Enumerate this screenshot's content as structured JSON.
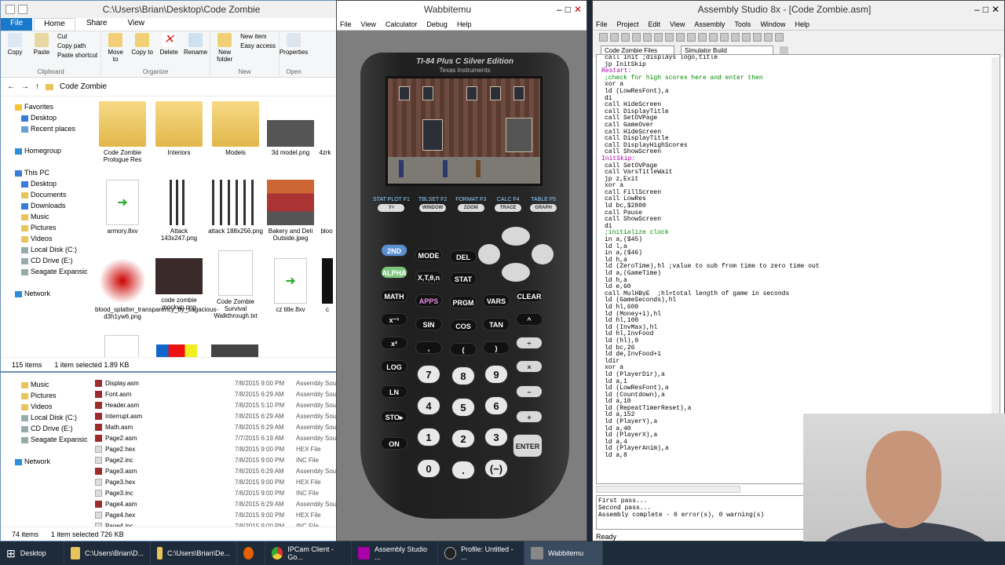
{
  "explorer": {
    "title": "C:\\Users\\Brian\\Desktop\\Code Zombie",
    "tabs": [
      "Home",
      "Share",
      "View"
    ],
    "file_tab": "File",
    "ribbon": {
      "clipboard": {
        "label": "Clipboard",
        "copy": "Copy",
        "paste": "Paste",
        "cut": "Cut",
        "copy_path": "Copy path",
        "paste_shortcut": "Paste shortcut"
      },
      "organize": {
        "label": "Organize",
        "move_to": "Move to",
        "copy_to": "Copy to",
        "delete": "Delete",
        "rename": "Rename"
      },
      "new": {
        "label": "New",
        "new_folder": "New folder",
        "new_item": "New item",
        "easy_access": "Easy access"
      },
      "open": {
        "label": "Open",
        "properties": "Properties"
      }
    },
    "breadcrumb": "Code Zombie",
    "nav": [
      {
        "label": "Favorites"
      },
      {
        "label": "Desktop"
      },
      {
        "label": "Recent places"
      },
      {
        "label": "Homegroup"
      },
      {
        "label": "This PC"
      },
      {
        "label": "Desktop"
      },
      {
        "label": "Documents"
      },
      {
        "label": "Downloads"
      },
      {
        "label": "Music"
      },
      {
        "label": "Pictures"
      },
      {
        "label": "Videos"
      },
      {
        "label": "Local Disk (C:)"
      },
      {
        "label": "CD Drive (E:)"
      },
      {
        "label": "Seagate Expansion D"
      },
      {
        "label": "Network"
      }
    ],
    "files": [
      {
        "label": "Code Zombie Prologue Res"
      },
      {
        "label": "Interiors"
      },
      {
        "label": "Models"
      },
      {
        "label": "3d model.png"
      },
      {
        "label": "4zrk"
      },
      {
        "label": "armory.8xv"
      },
      {
        "label": "Attack 143x247.png"
      },
      {
        "label": "attack 188x256.png"
      },
      {
        "label": "Bakery and Deli Outside.jpeg"
      },
      {
        "label": "bloo"
      },
      {
        "label": "blood_splatter_transparency_by_sagacious-d3h1yw6.png"
      },
      {
        "label": "code zombie mockup.png"
      },
      {
        "label": "Code Zombie Survival Walkthrough.txt"
      },
      {
        "label": "cz title.8xv"
      },
      {
        "label": "c"
      }
    ],
    "status_count": "115 items",
    "status_selected": "1 item selected  1.89 KB"
  },
  "explorer2": {
    "nav": [
      {
        "label": "Music"
      },
      {
        "label": "Pictures"
      },
      {
        "label": "Videos"
      },
      {
        "label": "Local Disk (C:)"
      },
      {
        "label": "CD Drive (E:)"
      },
      {
        "label": "Seagate Expansion D"
      },
      {
        "label": "Network"
      }
    ],
    "rows": [
      {
        "name": "Display.asm",
        "date": "7/8/2015 9:00 PM",
        "type": "Assembly Sou"
      },
      {
        "name": "Font.asm",
        "date": "7/8/2015 6:29 AM",
        "type": "Assembly Sou"
      },
      {
        "name": "Header.asm",
        "date": "7/8/2015 5:10 PM",
        "type": "Assembly Sou"
      },
      {
        "name": "Interrupt.asm",
        "date": "7/8/2015 6:29 AM",
        "type": "Assembly Sou"
      },
      {
        "name": "Math.asm",
        "date": "7/8/2015 6:29 AM",
        "type": "Assembly Sou"
      },
      {
        "name": "Page2.asm",
        "date": "7/7/2015 6:19 AM",
        "type": "Assembly Sou"
      },
      {
        "name": "Page2.hex",
        "date": "7/8/2015 9:00 PM",
        "type": "HEX File"
      },
      {
        "name": "Page2.inc",
        "date": "7/8/2015 9:00 PM",
        "type": "INC File"
      },
      {
        "name": "Page3.asm",
        "date": "7/8/2015 6:29 AM",
        "type": "Assembly Sou"
      },
      {
        "name": "Page3.hex",
        "date": "7/8/2015 9:00 PM",
        "type": "HEX File"
      },
      {
        "name": "Page3.inc",
        "date": "7/8/2015 9:00 PM",
        "type": "INC File"
      },
      {
        "name": "Page4.asm",
        "date": "7/8/2015 6:29 AM",
        "type": "Assembly Sou"
      },
      {
        "name": "Page4.hex",
        "date": "7/8/2015 9:00 PM",
        "type": "HEX File"
      },
      {
        "name": "Page4.inc",
        "date": "7/8/2015 9:00 PM",
        "type": "INC File"
      }
    ],
    "status_count": "74 items",
    "status_selected": "1 item selected  726 KB"
  },
  "wabbit": {
    "title": "Wabbitemu",
    "menu": [
      "File",
      "View",
      "Calculator",
      "Debug",
      "Help"
    ],
    "model": "TI-84 Plus C Silver Edition",
    "brand": "Texas Instruments",
    "fkeys": [
      {
        "top": "STAT PLOT F1",
        "key": "Y="
      },
      {
        "top": "TBLSET F2",
        "key": "WINDOW"
      },
      {
        "top": "FORMAT F3",
        "key": "ZOOM"
      },
      {
        "top": "CALC F4",
        "key": "TRACE"
      },
      {
        "top": "TABLE F5",
        "key": "GRAPH"
      }
    ],
    "keys": {
      "second": "2ND",
      "mode": "MODE",
      "del": "DEL",
      "alpha": "ALPHA",
      "xton": "X,T,θ,n",
      "stat": "STAT",
      "math": "MATH",
      "apps": "APPS",
      "prgm": "PRGM",
      "vars": "VARS",
      "clear": "CLEAR",
      "xinv": "x⁻¹",
      "sin": "SIN",
      "cos": "COS",
      "tan": "TAN",
      "pow": "^",
      "sq": "x²",
      "comma": ",",
      "lp": "(",
      "rp": ")",
      "div": "÷",
      "log": "LOG",
      "n7": "7",
      "n8": "8",
      "n9": "9",
      "mul": "×",
      "ln": "LN",
      "n4": "4",
      "n5": "5",
      "n6": "6",
      "sub": "−",
      "sto": "STO▸",
      "n1": "1",
      "n2": "2",
      "n3": "3",
      "add": "+",
      "on": "ON",
      "n0": "0",
      "dot": ".",
      "neg": "(−)",
      "enter": "ENTER"
    }
  },
  "asm": {
    "title": "Assembly Studio 8x - [Code Zombie.asm]",
    "menu": [
      "File",
      "Project",
      "Edit",
      "View",
      "Assembly",
      "Tools",
      "Window",
      "Help"
    ],
    "combo_files": "Code Zombie Files",
    "combo_build": "Simulator Build",
    "code": [
      {
        "c": "l",
        "t": "call Init ;displays logo,title"
      },
      {
        "c": "l",
        "t": "jp InitSkip"
      },
      {
        "c": "lbl",
        "t": "Restart:"
      },
      {
        "c": "cm",
        "t": ";check for high scores here and enter then"
      },
      {
        "c": "l",
        "t": "xor a"
      },
      {
        "c": "l",
        "t": "ld (LowResFont),a"
      },
      {
        "c": "l",
        "t": "di"
      },
      {
        "c": "l",
        "t": "call HideScreen"
      },
      {
        "c": "l",
        "t": "call DisplayTitle"
      },
      {
        "c": "l",
        "t": "call SetOVPage"
      },
      {
        "c": "l",
        "t": "call GameOver"
      },
      {
        "c": "l",
        "t": "call HideScreen"
      },
      {
        "c": "l",
        "t": "call DisplayTitle"
      },
      {
        "c": "l",
        "t": "call DisplayHighScores"
      },
      {
        "c": "l",
        "t": "call ShowScreen"
      },
      {
        "c": "lbl",
        "t": "InitSkip:"
      },
      {
        "c": "l",
        "t": "call SetOVPage"
      },
      {
        "c": "l",
        "t": "call VarsTitleWait"
      },
      {
        "c": "l",
        "t": "jp z,Exit"
      },
      {
        "c": "l",
        "t": "xor a"
      },
      {
        "c": "l",
        "t": "call FillScreen"
      },
      {
        "c": "l",
        "t": "call LowRes"
      },
      {
        "c": "l",
        "t": "ld bc,$2800"
      },
      {
        "c": "l",
        "t": "call Pause"
      },
      {
        "c": "l",
        "t": "call ShowScreen"
      },
      {
        "c": "l",
        "t": ""
      },
      {
        "c": "l",
        "t": "di"
      },
      {
        "c": "cm",
        "t": ";initialize clock"
      },
      {
        "c": "l",
        "t": "in a,($45)"
      },
      {
        "c": "l",
        "t": "ld l,a"
      },
      {
        "c": "l",
        "t": "in a,($46)"
      },
      {
        "c": "l",
        "t": "ld h,a"
      },
      {
        "c": "l",
        "t": "ld (ZeroTime),hl ;value to sub from time to zero time out"
      },
      {
        "c": "l",
        "t": "ld a,(GameTime)"
      },
      {
        "c": "l",
        "t": "ld h,a"
      },
      {
        "c": "l",
        "t": "ld e,60"
      },
      {
        "c": "l",
        "t": "call MulHByE  ;hl=total length of game in seconds"
      },
      {
        "c": "l",
        "t": "ld (GameSeconds),hl"
      },
      {
        "c": "l",
        "t": ""
      },
      {
        "c": "l",
        "t": "ld hl,600"
      },
      {
        "c": "l",
        "t": "ld (Money+1),hl"
      },
      {
        "c": "l",
        "t": "ld hl,100"
      },
      {
        "c": "l",
        "t": "ld (InvMax),hl"
      },
      {
        "c": "l",
        "t": "ld hl,InvFood"
      },
      {
        "c": "l",
        "t": "ld (hl),0"
      },
      {
        "c": "l",
        "t": "ld bc,26"
      },
      {
        "c": "l",
        "t": "ld de,InvFood+1"
      },
      {
        "c": "l",
        "t": "ldir"
      },
      {
        "c": "l",
        "t": ""
      },
      {
        "c": "l",
        "t": "xor a"
      },
      {
        "c": "l",
        "t": "ld (PlayerDir),a"
      },
      {
        "c": "l",
        "t": "ld a,1"
      },
      {
        "c": "l",
        "t": "ld (LowResFont),a"
      },
      {
        "c": "l",
        "t": "ld (Countdown),a"
      },
      {
        "c": "l",
        "t": "ld a,10"
      },
      {
        "c": "l",
        "t": "ld (RepeatTimerReset),a"
      },
      {
        "c": "l",
        "t": "ld a,152"
      },
      {
        "c": "l",
        "t": "ld (PlayerY),a"
      },
      {
        "c": "l",
        "t": "ld a,40"
      },
      {
        "c": "l",
        "t": "ld (PlayerX),a"
      },
      {
        "c": "l",
        "t": "ld a,4"
      },
      {
        "c": "l",
        "t": "ld (PlayerAnim),a"
      },
      {
        "c": "l",
        "t": "ld a,8"
      }
    ],
    "output": [
      "First pass...",
      "Second pass...",
      "Assembly complete - 0 error(s), 0 warning(s)"
    ],
    "status": "Ready"
  },
  "taskbar": [
    {
      "label": "Desktop",
      "icon": "desktop-icon"
    },
    {
      "label": "C:\\Users\\Brian\\D...",
      "icon": "folder-icon"
    },
    {
      "label": "C:\\Users\\Brian\\De...",
      "icon": "folder-icon"
    },
    {
      "label": "",
      "icon": "firefox-icon"
    },
    {
      "label": "IPCam Client - Go...",
      "icon": "chrome-icon"
    },
    {
      "label": "Assembly Studio ...",
      "icon": "asm-icon"
    },
    {
      "label": "Profile: Untitled - ...",
      "icon": "obs-icon"
    },
    {
      "label": "Wabbitemu",
      "icon": "calculator-icon"
    }
  ]
}
